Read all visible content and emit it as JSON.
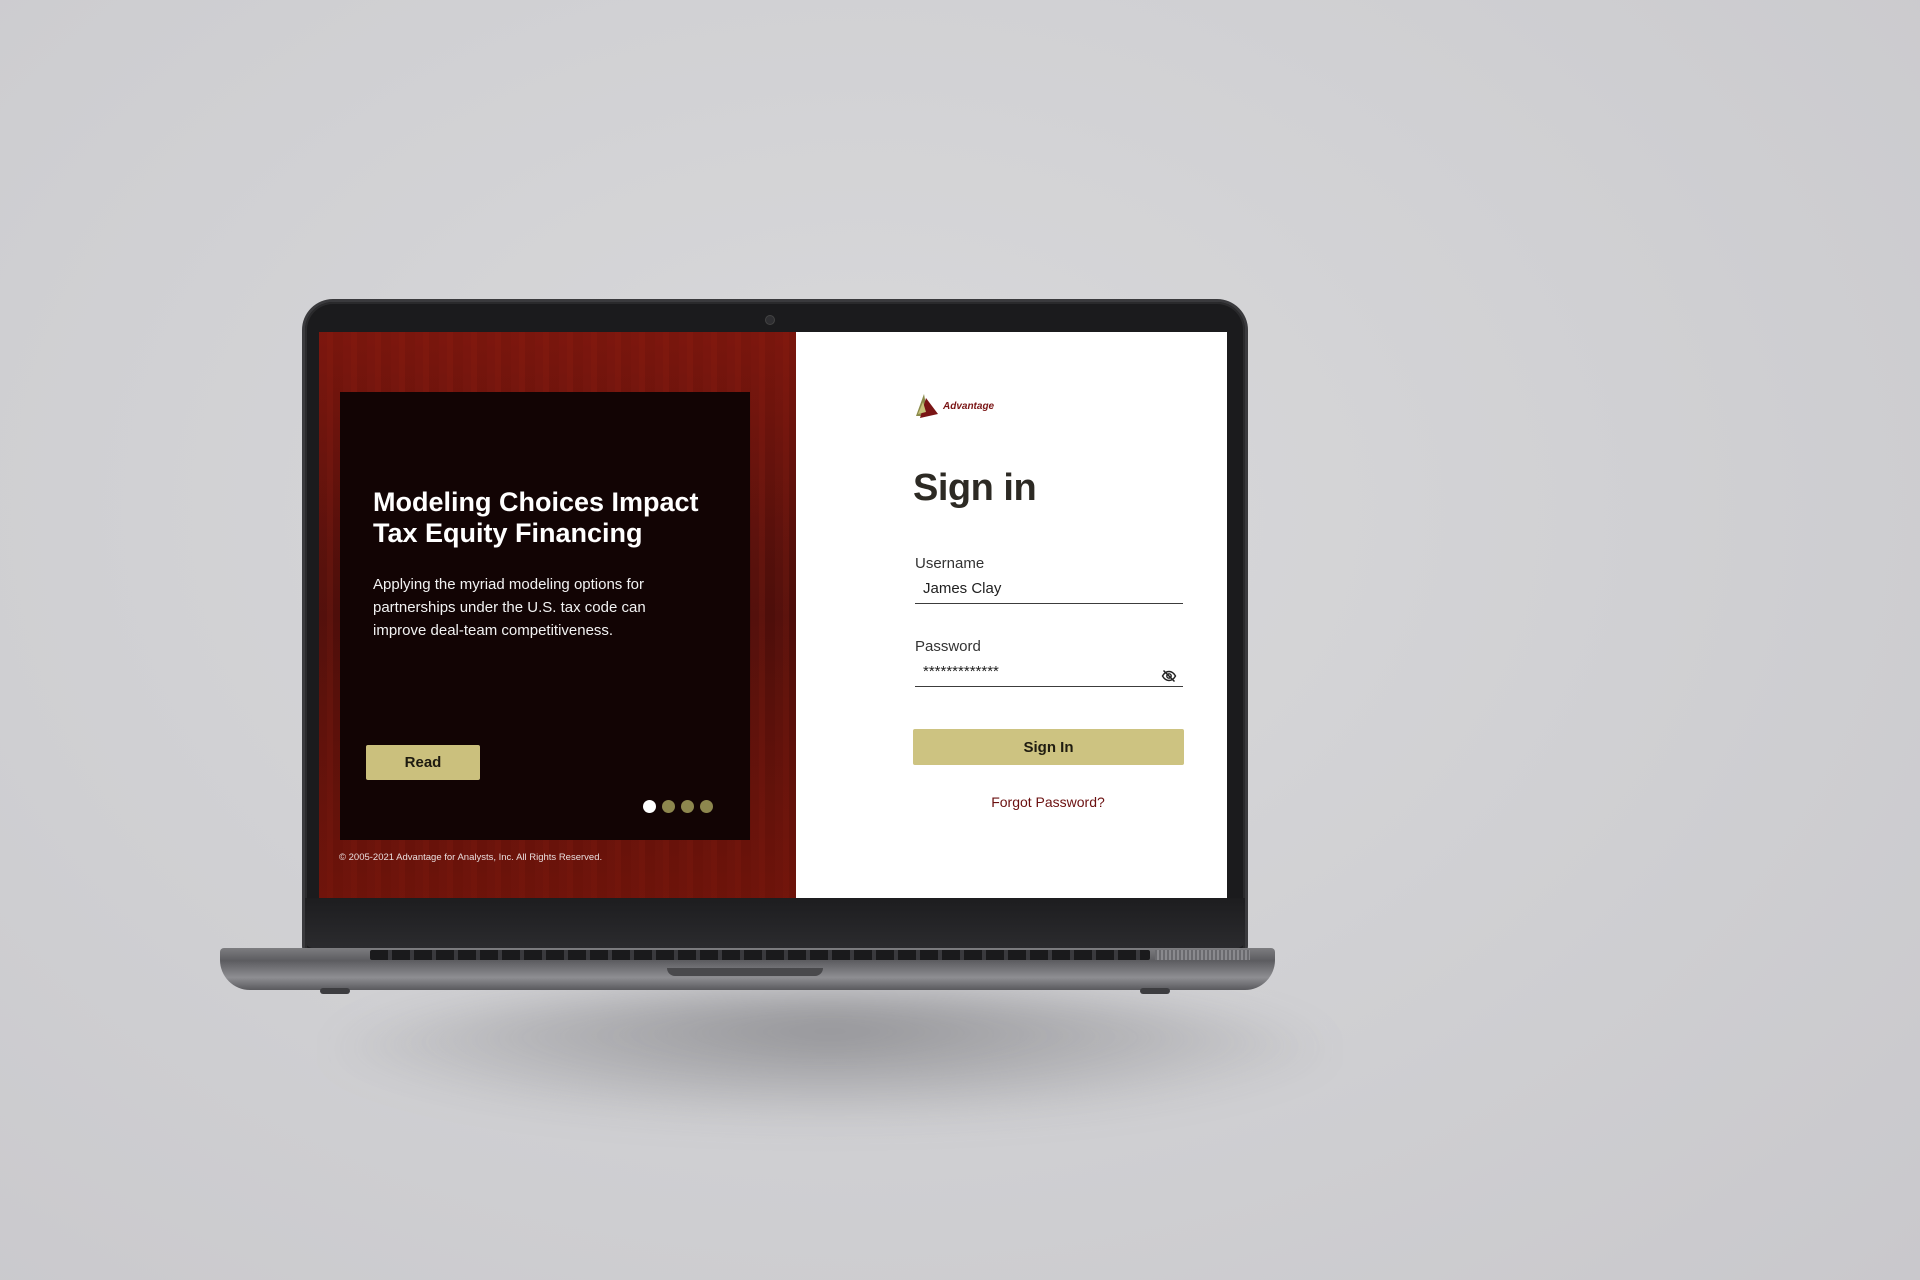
{
  "promo": {
    "title": "Modeling Choices Impact Tax Equity Financing",
    "description": "Applying the myriad modeling options for partnerships under the U.S. tax code can improve deal-team competitiveness.",
    "read_label": "Read",
    "dots": {
      "count": 4,
      "active_index": 0
    },
    "copyright": "© 2005-2021 Advantage for Analysts, Inc. All Rights Reserved."
  },
  "signin": {
    "logo_text": "Advantage",
    "title": "Sign in",
    "username_label": "Username",
    "username_value": "James Clay",
    "password_label": "Password",
    "password_value": "*************",
    "password_toggle_icon": "eye-slash-icon",
    "button_label": "Sign In",
    "forgot_label": "Forgot Password?"
  },
  "colors": {
    "brand_red": "#7a1515",
    "accent_gold": "#cdc381",
    "promo_card": "#120404",
    "dot_inactive": "#8d874e"
  }
}
